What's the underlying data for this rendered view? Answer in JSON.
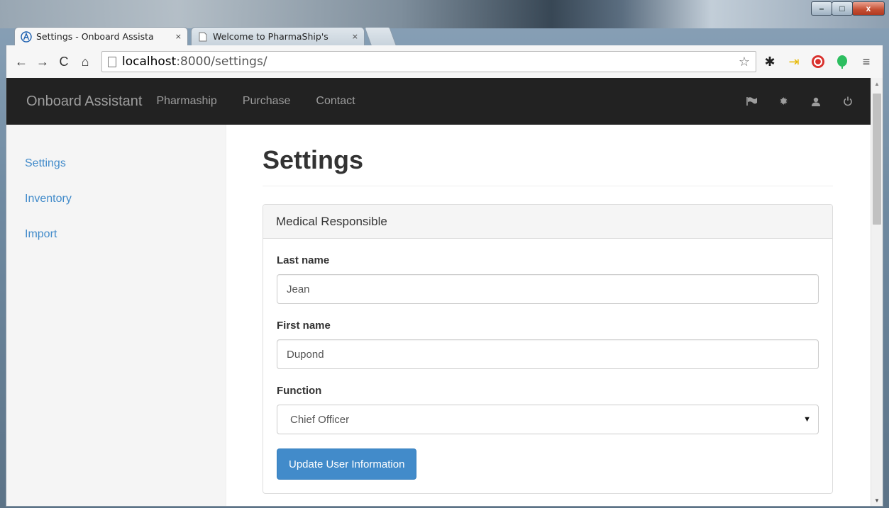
{
  "browser": {
    "tabs": [
      {
        "title": "Settings - Onboard Assista",
        "close": "×",
        "icon": "A",
        "active": true
      },
      {
        "title": "Welcome to PharmaShip's",
        "close": "×",
        "icon": "page",
        "active": false
      }
    ],
    "address": {
      "host": "localhost",
      "rest": ":8000/settings/"
    },
    "window_controls": {
      "minimize": "–",
      "maximize": "□",
      "close": "x"
    }
  },
  "navbar": {
    "brand": "Onboard Assistant",
    "links": [
      "Pharmaship",
      "Purchase",
      "Contact"
    ],
    "right_icons": [
      "flag-icon",
      "gear-icon",
      "user-icon",
      "power-icon"
    ]
  },
  "sidebar": {
    "items": [
      {
        "label": "Settings"
      },
      {
        "label": "Inventory"
      },
      {
        "label": "Import"
      }
    ]
  },
  "main": {
    "title": "Settings",
    "panel": {
      "heading": "Medical Responsible",
      "last_name_label": "Last name",
      "last_name_value": "Jean",
      "first_name_label": "First name",
      "first_name_value": "Dupond",
      "function_label": "Function",
      "function_value": "Chief Officer",
      "submit_label": "Update User Information"
    }
  },
  "colors": {
    "navbar_bg": "#222222",
    "link": "#428bca",
    "primary_button": "#428bca"
  }
}
